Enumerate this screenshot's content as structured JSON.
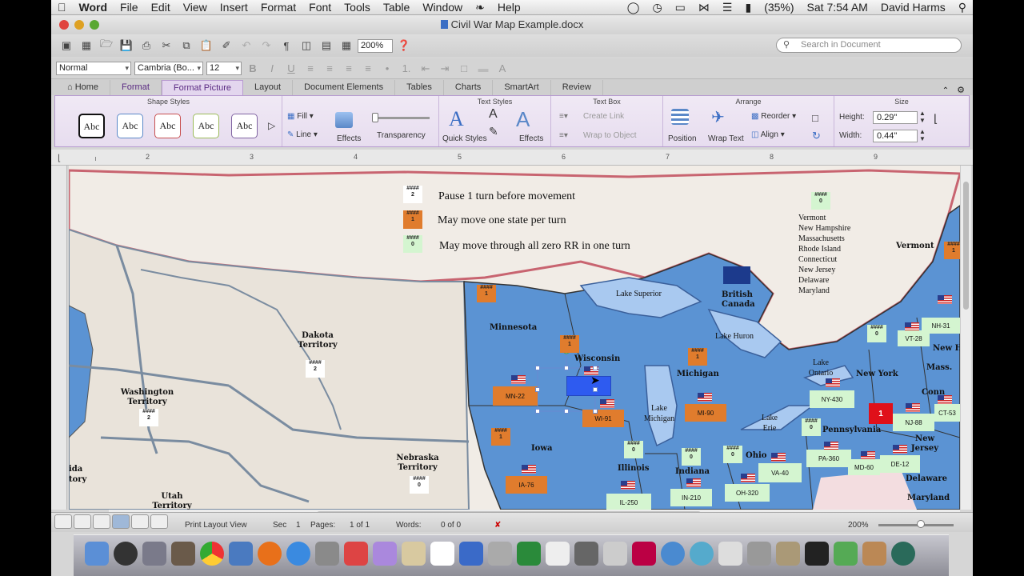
{
  "menubar": {
    "app": "Word",
    "items": [
      "File",
      "Edit",
      "View",
      "Insert",
      "Format",
      "Font",
      "Tools",
      "Table",
      "Window",
      "Help"
    ],
    "battery": "(35%)",
    "clock": "Sat 7:54 AM",
    "user": "David Harms"
  },
  "window": {
    "title": "Civil War Map Example.docx"
  },
  "toolbar": {
    "zoom": "200%",
    "search_placeholder": "Search in Document"
  },
  "formatting": {
    "style": "Normal",
    "font": "Cambria (Bo...",
    "size": "12"
  },
  "tabs": [
    "Home",
    "Format",
    "Format Picture",
    "Layout",
    "Document Elements",
    "Tables",
    "Charts",
    "SmartArt",
    "Review"
  ],
  "ribbon": {
    "shape_styles": {
      "title": "Shape Styles",
      "samples": [
        "Abc",
        "Abc",
        "Abc",
        "Abc",
        "Abc"
      ],
      "fill": "Fill",
      "line": "Line",
      "effects": "Effects",
      "transparency": "Transparency"
    },
    "text_styles": {
      "title": "Text Styles",
      "quick_styles": "Quick Styles",
      "effects": "Effects"
    },
    "text_box": {
      "title": "Text Box",
      "create_link": "Create Link",
      "wrap_to_object": "Wrap to Object"
    },
    "arrange": {
      "title": "Arrange",
      "position": "Position",
      "wrap_text": "Wrap Text",
      "reorder": "Reorder",
      "align": "Align"
    },
    "size": {
      "title": "Size",
      "height_label": "Height:",
      "height": "0.29\"",
      "width_label": "Width:",
      "width": "0.44\""
    }
  },
  "ruler": [
    "2",
    "3",
    "4",
    "5",
    "6",
    "7",
    "8",
    "9"
  ],
  "map": {
    "legend": [
      {
        "rr": "2",
        "text": "Pause 1 turn before movement"
      },
      {
        "rr": "1",
        "text": "May move one state per turn"
      },
      {
        "rr": "0",
        "text": "May move through all zero RR in one turn"
      }
    ],
    "ne_rr": "0",
    "ne_list": [
      "Vermont",
      "New Hampshire",
      "Massachusetts",
      "Rhode Island",
      "Connecticut",
      "New Jersey",
      "Delaware",
      "Maryland"
    ],
    "regions": [
      "Dakota Territory",
      "Washington Territory",
      "Nebraska Territory",
      "Utah Territory",
      "Minnesota",
      "Wisconsin",
      "Iowa",
      "Michigan",
      "Illinois",
      "Indiana",
      "Ohio",
      "Pennsylvania",
      "New York",
      "British Canada",
      "Vermont",
      "Mass.",
      "Conn",
      "New Jersey",
      "Delaware",
      "Maryland",
      "New Hamps",
      "ida",
      "tory"
    ],
    "lakes": [
      "Lake Superior",
      "Lake Huron",
      "Lake Michigan",
      "Lake Erie",
      "Lake Ontario"
    ],
    "units": [
      "MN-22",
      "WI-91",
      "IA-76",
      "MI-90",
      "IL-250",
      "IN-210",
      "OH-320",
      "VA-40",
      "NY-430",
      "PA-360",
      "MD-60",
      "DE-12",
      "NJ-88",
      "CT-53",
      "VT-28",
      "NH-31"
    ],
    "rr_values": [
      "2",
      "2",
      "1",
      "1",
      "1",
      "1",
      "0",
      "0",
      "0",
      "0",
      "0",
      "0",
      "0",
      "1"
    ],
    "red_marker": "1"
  },
  "status": {
    "view": "Print Layout View",
    "sec_label": "Sec",
    "sec": "1",
    "pages_label": "Pages:",
    "pages": "1 of 1",
    "words_label": "Words:",
    "words": "0 of 0",
    "zoom": "200%"
  }
}
